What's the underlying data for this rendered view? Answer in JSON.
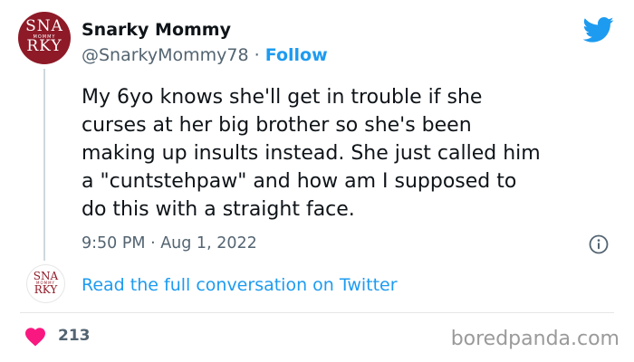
{
  "author": {
    "avatar_monogram_top": "SNA",
    "avatar_monogram_bottom": "RKY",
    "avatar_band": "MOMMY",
    "display_name": "Snarky Mommy",
    "handle": "@SnarkyMommy78",
    "separator": "·",
    "follow_label": "Follow"
  },
  "tweet": {
    "text": "My 6yo knows she'll get in trouble if she\ncurses at her big brother so she's been\nmaking up insults instead. She just called him\na \"cuntstehpaw\" and how am I supposed to\ndo this with a straight face.",
    "timestamp": "9:50 PM · Aug 1, 2022"
  },
  "reply_prompt": {
    "link_label": "Read the full conversation on Twitter"
  },
  "engagement": {
    "like_count": "213"
  },
  "watermark": "boredpanda.com",
  "colors": {
    "accent": "#1d9bf0",
    "heart": "#f91880",
    "avatar_bg": "#8e1a27",
    "muted_text": "#536471"
  },
  "icons": {
    "brand": "twitter-bird-icon",
    "info": "info-icon",
    "like": "heart-icon"
  }
}
